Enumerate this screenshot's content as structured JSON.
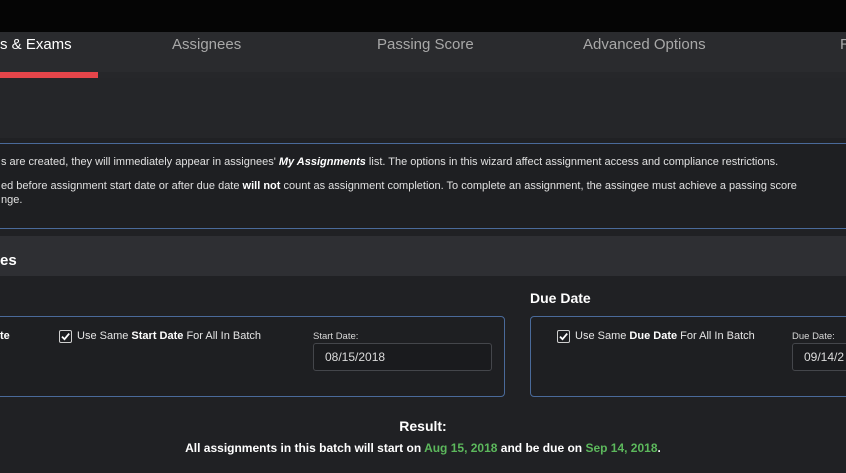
{
  "tabs": [
    {
      "label": "s & Exams",
      "active": true
    },
    {
      "label": "Assignees",
      "active": false
    },
    {
      "label": "Passing Score",
      "active": false
    },
    {
      "label": "Advanced Options",
      "active": false
    },
    {
      "label": "R",
      "active": false
    }
  ],
  "info": {
    "line1_pre": "s are created, they will immediately appear in assignees' ",
    "line1_bold": "My Assignments",
    "line1_post": " list. The options in this wizard affect assignment access and compliance restrictions.",
    "line2_pre": "ed before assignment start date or after due date ",
    "line2_bold": "will not",
    "line2_post": " count as assignment completion. To complete an assignment, the assingee must achieve a passing score",
    "line3": "nge."
  },
  "section": {
    "title": "es"
  },
  "start": {
    "partial_label": "te",
    "checkbox_pre": "Use Same ",
    "checkbox_bold": "Start Date",
    "checkbox_post": " For All In Batch",
    "checked": true,
    "field_label": "Start Date:",
    "value": "08/15/2018"
  },
  "due": {
    "heading": "Due Date",
    "checkbox_pre": "Use Same ",
    "checkbox_bold": "Due Date",
    "checkbox_post": " For All In Batch",
    "checked": true,
    "field_label": "Due Date:",
    "value": "09/14/2"
  },
  "result": {
    "heading": "Result:",
    "pre": "All assignments in this batch will start on ",
    "start_date": "Aug 15, 2018",
    "mid": " and be due on ",
    "due_date": "Sep 14, 2018",
    "post": "."
  },
  "colors": {
    "accent_red": "#e5454a",
    "border_blue": "#4a6a9a",
    "date_green": "#5cb85c"
  }
}
